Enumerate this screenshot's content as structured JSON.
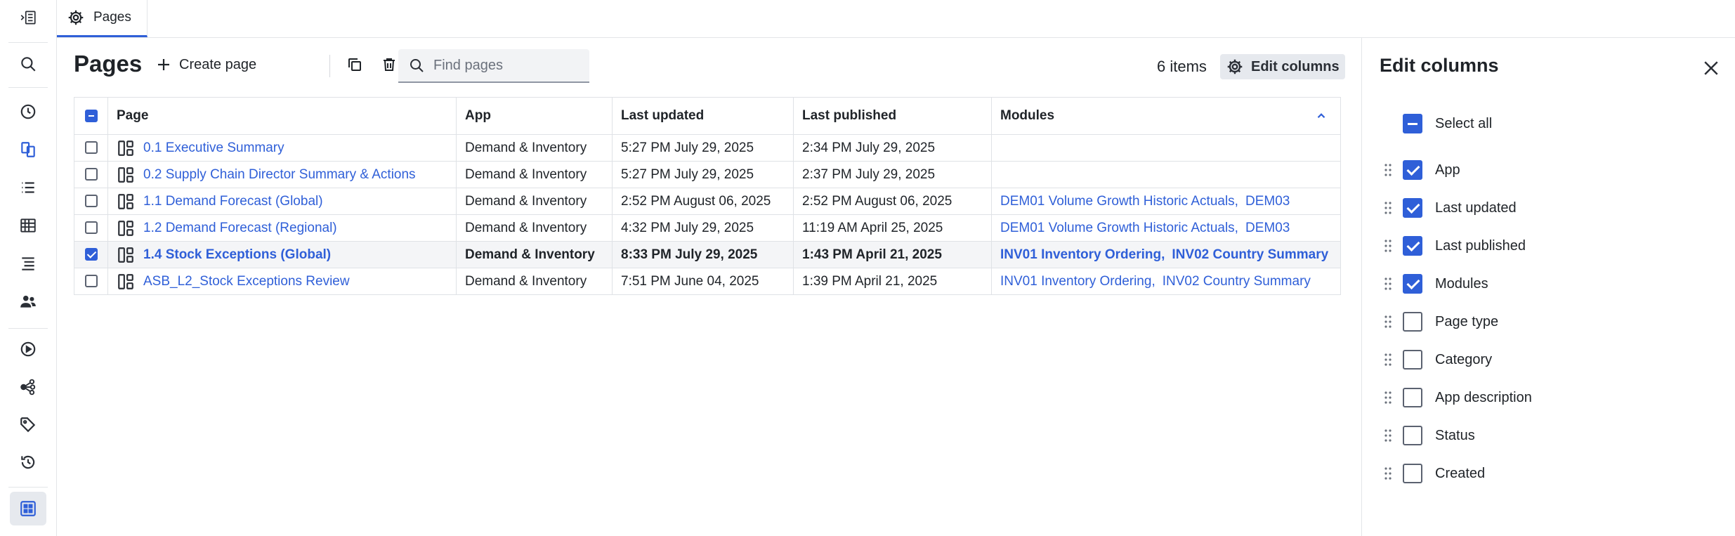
{
  "tab": {
    "label": "Pages"
  },
  "toolbar": {
    "title": "Pages",
    "create_label": "Create page",
    "search_placeholder": "Find pages",
    "count": "6 items",
    "edit_columns_label": "Edit columns"
  },
  "table": {
    "headers": {
      "page": "Page",
      "app": "App",
      "last_updated": "Last updated",
      "last_published": "Last published",
      "modules": "Modules"
    },
    "rows": [
      {
        "checked": false,
        "page": "0.1 Executive Summary",
        "app": "Demand & Inventory",
        "last_updated": "5:27 PM July 29, 2025",
        "last_published": "2:34 PM July 29, 2025",
        "module_a": "",
        "module_b": ""
      },
      {
        "checked": false,
        "page": "0.2 Supply Chain Director Summary & Actions",
        "app": "Demand & Inventory",
        "last_updated": "5:27 PM July 29, 2025",
        "last_published": "2:37 PM July 29, 2025",
        "module_a": "",
        "module_b": ""
      },
      {
        "checked": false,
        "page": "1.1 Demand Forecast (Global)",
        "app": "Demand & Inventory",
        "last_updated": "2:52 PM August 06, 2025",
        "last_published": "2:52 PM August 06, 2025",
        "module_a": "DEM01 Volume Growth Historic Actuals,",
        "module_b": "DEM03"
      },
      {
        "checked": false,
        "page": "1.2 Demand Forecast (Regional)",
        "app": "Demand & Inventory",
        "last_updated": "4:32 PM July 29, 2025",
        "last_published": "11:19 AM April 25, 2025",
        "module_a": "DEM01 Volume Growth Historic Actuals,",
        "module_b": "DEM03"
      },
      {
        "checked": true,
        "page": "1.4 Stock Exceptions (Global)",
        "app": "Demand & Inventory",
        "last_updated": "8:33 PM July 29, 2025",
        "last_published": "1:43 PM April 21, 2025",
        "module_a": "INV01 Inventory Ordering,",
        "module_b": "INV02 Country Summary"
      },
      {
        "checked": false,
        "page": "ASB_L2_Stock Exceptions Review",
        "app": "Demand & Inventory",
        "last_updated": "7:51 PM June 04, 2025",
        "last_published": "1:39 PM April 21, 2025",
        "module_a": "INV01 Inventory Ordering,",
        "module_b": "INV02 Country Summary"
      }
    ]
  },
  "panel": {
    "title": "Edit columns",
    "select_all_label": "Select all",
    "options": [
      {
        "label": "App",
        "checked": true
      },
      {
        "label": "Last updated",
        "checked": true
      },
      {
        "label": "Last published",
        "checked": true
      },
      {
        "label": "Modules",
        "checked": true
      },
      {
        "label": "Page type",
        "checked": false
      },
      {
        "label": "Category",
        "checked": false
      },
      {
        "label": "App description",
        "checked": false
      },
      {
        "label": "Status",
        "checked": false
      },
      {
        "label": "Created",
        "checked": false
      }
    ]
  },
  "colors": {
    "accent": "#2f5fd8",
    "border": "#dfe2e6",
    "selected_row": "#f4f5f7"
  },
  "icons": {
    "rail": [
      "expand-sidebar-icon",
      "search-icon",
      "history-icon",
      "copy-pages-icon",
      "list-icon",
      "grid-table-icon",
      "outline-list-icon",
      "users-icon",
      "play-circle-icon",
      "network-icon",
      "tag-icon",
      "restore-history-icon",
      "apps-grid-icon"
    ]
  }
}
